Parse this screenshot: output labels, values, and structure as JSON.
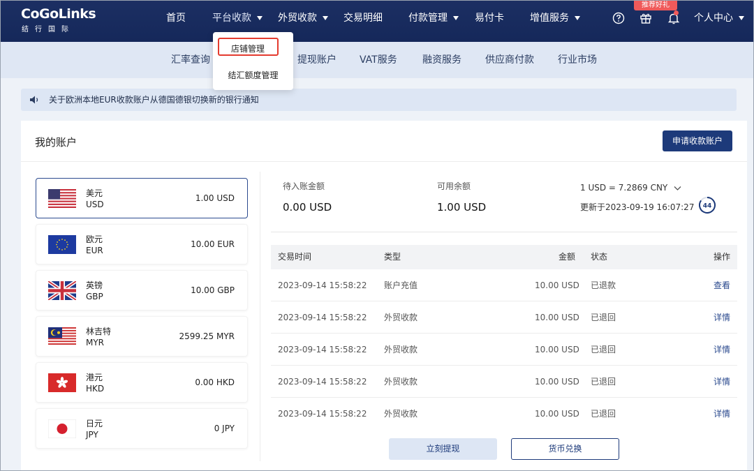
{
  "brand": {
    "logo_main": "CoGoLinks",
    "logo_sub": "结行国际"
  },
  "topnav": {
    "items": [
      {
        "label": "首页"
      },
      {
        "label": "平台收款"
      },
      {
        "label": "外贸收款"
      },
      {
        "label": "交易明细"
      },
      {
        "label": "付款管理"
      },
      {
        "label": "易付卡"
      },
      {
        "label": "增值服务"
      }
    ],
    "gift_tag": "推荐好礼",
    "user_menu": "个人中心",
    "icons": [
      "help-icon",
      "gift-icon",
      "bell-icon"
    ]
  },
  "dropdown": {
    "items": [
      {
        "label": "店铺管理"
      },
      {
        "label": "结汇额度管理"
      }
    ]
  },
  "subnav": {
    "items": [
      {
        "label": "汇率查询"
      },
      {
        "label": "提现账户"
      },
      {
        "label": "VAT服务"
      },
      {
        "label": "融资服务"
      },
      {
        "label": "供应商付款"
      },
      {
        "label": "行业市场"
      }
    ]
  },
  "notice": {
    "text": "关于欧洲本地EUR收款账户从德国德银切换新的银行通知"
  },
  "main": {
    "title": "我的账户",
    "apply_button": "申请收款账户",
    "accounts": [
      {
        "name": "美元",
        "code": "USD",
        "balance": "1.00 USD",
        "flag": "us-flag"
      },
      {
        "name": "欧元",
        "code": "EUR",
        "balance": "10.00 EUR",
        "flag": "eu-flag"
      },
      {
        "name": "英镑",
        "code": "GBP",
        "balance": "10.00 GBP",
        "flag": "uk-flag"
      },
      {
        "name": "林吉特",
        "code": "MYR",
        "balance": "2599.25 MYR",
        "flag": "my-flag"
      },
      {
        "name": "港元",
        "code": "HKD",
        "balance": "0.00 HKD",
        "flag": "hk-flag"
      },
      {
        "name": "日元",
        "code": "JPY",
        "balance": "0 JPY",
        "flag": "jp-flag"
      }
    ],
    "summary": {
      "pending_label": "待入账金额",
      "pending_value": "0.00 USD",
      "available_label": "可用余额",
      "available_value": "1.00 USD",
      "rate": "1 USD = 7.2869 CNY",
      "updated": "更新于2023-09-19 16:07:27",
      "countdown": "44"
    },
    "table": {
      "headers": {
        "time": "交易时间",
        "type": "类型",
        "amount": "金额",
        "status": "状态",
        "action": "操作"
      },
      "rows": [
        {
          "time": "2023-09-14 15:58:22",
          "type": "账户充值",
          "amount": "10.00 USD",
          "status": "已退款",
          "action": "查看"
        },
        {
          "time": "2023-09-14 15:58:22",
          "type": "外贸收款",
          "amount": "10.00 USD",
          "status": "已退回",
          "action": "详情"
        },
        {
          "time": "2023-09-14 15:58:22",
          "type": "外贸收款",
          "amount": "10.00 USD",
          "status": "已退回",
          "action": "详情"
        },
        {
          "time": "2023-09-14 15:58:22",
          "type": "外贸收款",
          "amount": "10.00 USD",
          "status": "已退回",
          "action": "详情"
        },
        {
          "time": "2023-09-14 15:58:22",
          "type": "外贸收款",
          "amount": "10.00 USD",
          "status": "已退回",
          "action": "详情"
        }
      ]
    },
    "withdraw_button": "立刻提现",
    "exchange_button": "货币兑换"
  },
  "colors": {
    "nav_bg": "#15285a",
    "accent": "#1d3a7a",
    "highlight_border": "#e43b2f",
    "gift_tag": "#ef5a5a"
  }
}
